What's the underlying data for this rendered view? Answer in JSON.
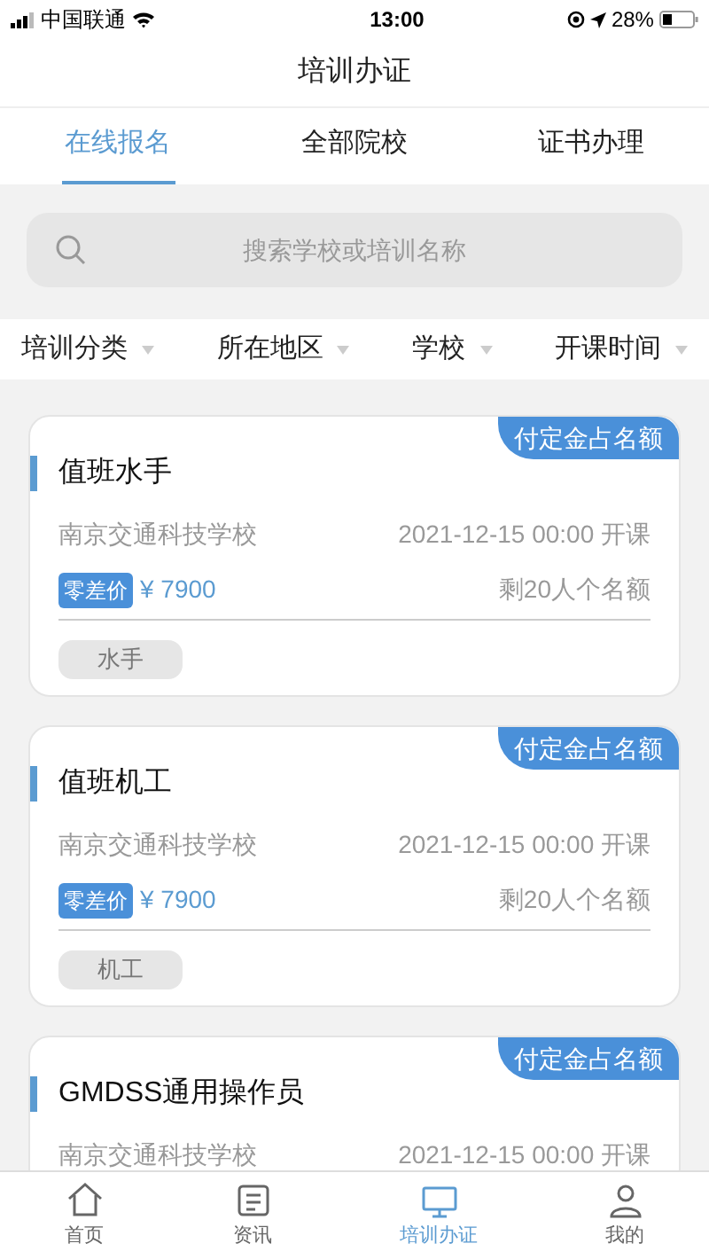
{
  "status_bar": {
    "carrier": "中国联通",
    "time": "13:00",
    "battery": "28%"
  },
  "title": "培训办证",
  "tabs": [
    {
      "label": "在线报名",
      "selected": true
    },
    {
      "label": "全部院校",
      "selected": false
    },
    {
      "label": "证书办理",
      "selected": false
    }
  ],
  "search": {
    "placeholder": "搜索学校或培训名称"
  },
  "filters": [
    {
      "label": "培训分类"
    },
    {
      "label": "所在地区"
    },
    {
      "label": "学校"
    },
    {
      "label": "开课时间"
    }
  ],
  "courses": [
    {
      "badge": "付定金占名额",
      "name": "值班水手",
      "school": "南京交通科技学校",
      "start": "2021-12-15 00:00 开课",
      "price_tag": "零差价",
      "price": "¥ 7900",
      "remaining": "剩20人个名额",
      "tag": "水手"
    },
    {
      "badge": "付定金占名额",
      "name": "值班机工",
      "school": "南京交通科技学校",
      "start": "2021-12-15 00:00 开课",
      "price_tag": "零差价",
      "price": "¥ 7900",
      "remaining": "剩20人个名额",
      "tag": "机工"
    },
    {
      "badge": "付定金占名额",
      "name": "GMDSS通用操作员",
      "school": "南京交通科技学校",
      "start": "2021-12-15 00:00 开课"
    }
  ],
  "bottom_nav": [
    {
      "label": "首页",
      "kind": "home",
      "selected": false
    },
    {
      "label": "资讯",
      "kind": "news",
      "selected": false
    },
    {
      "label": "培训办证",
      "kind": "training",
      "selected": true
    },
    {
      "label": "我的",
      "kind": "profile",
      "selected": false
    }
  ]
}
